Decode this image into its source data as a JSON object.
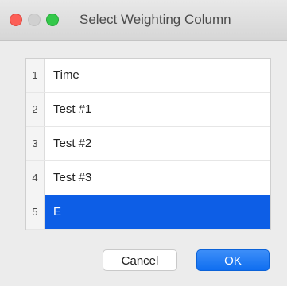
{
  "window": {
    "title": "Select Weighting Column"
  },
  "list": {
    "rows": [
      {
        "index": "1",
        "label": "Time",
        "selected": false
      },
      {
        "index": "2",
        "label": "Test #1",
        "selected": false
      },
      {
        "index": "3",
        "label": "Test #2",
        "selected": false
      },
      {
        "index": "4",
        "label": "Test #3",
        "selected": false
      },
      {
        "index": "5",
        "label": "E",
        "selected": true
      }
    ]
  },
  "buttons": {
    "cancel_label": "Cancel",
    "ok_label": "OK"
  },
  "colors": {
    "selection": "#0d5ee6",
    "ok_button": "#1a73f0"
  },
  "icons": {
    "close": "close-traffic-light-icon",
    "minimize": "minimize-traffic-light-icon",
    "zoom": "zoom-traffic-light-icon"
  }
}
